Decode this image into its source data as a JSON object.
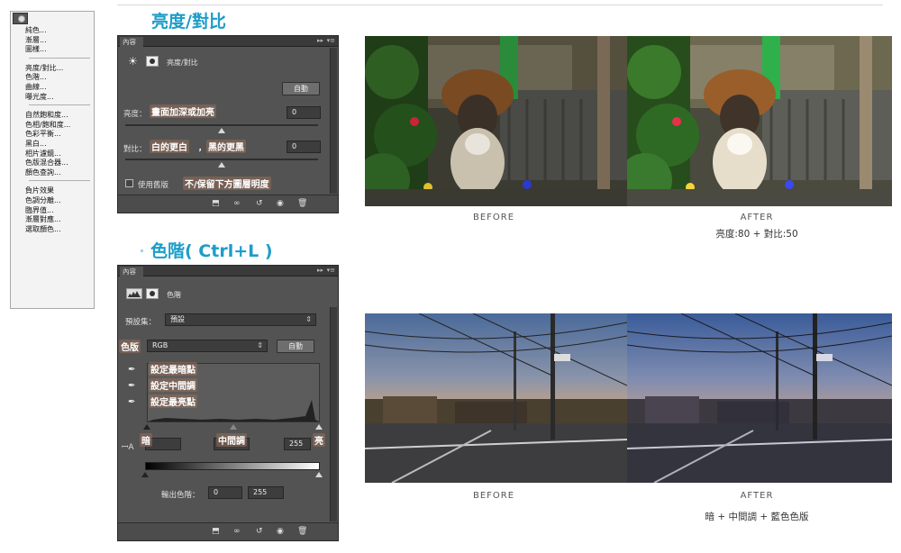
{
  "menu": {
    "items": [
      "純色...",
      "漸層...",
      "圖樣...",
      "—",
      "亮度/對比...",
      "色階...",
      "曲線...",
      "曝光度...",
      "—",
      "自然飽和度...",
      "色相/飽和度...",
      "色彩平衡...",
      "黑白...",
      "相片濾鏡...",
      "色版混合器...",
      "顏色查詢...",
      "—",
      "負片效果",
      "色調分離...",
      "臨界值...",
      "漸層對應...",
      "選取顏色..."
    ]
  },
  "section1": {
    "title": "亮度/對比",
    "panel": {
      "tab": "內容",
      "title": "亮度/對比",
      "auto_button": "自動",
      "brightness_label": "亮度：",
      "brightness_note": "畫面加深或加亮",
      "brightness_value": "0",
      "contrast_label": "對比：",
      "contrast_note_a": "白的更白",
      "contrast_note_sep": "，",
      "contrast_note_b": "黑的更黑",
      "contrast_value": "0",
      "legacy_label": "使用舊版",
      "legacy_note": "不/保留下方圖層明度"
    },
    "before_caption": "BEFORE",
    "after_caption": "AFTER",
    "after_sub": "亮度:80 + 對比:50"
  },
  "section2": {
    "title": "色階( Ctrl+L )",
    "panel": {
      "tab": "內容",
      "title": "色階",
      "preset_label": "預設集：",
      "preset_value": "預設",
      "channel_note": "色版",
      "channel_value": "RGB",
      "auto_button": "自動",
      "eyedrop_black": "設定最暗點",
      "eyedrop_gray": "設定中間調",
      "eyedrop_white": "設定最亮點",
      "shadow_note": "暗",
      "mid_note": "中間調",
      "high_note": "亮",
      "input_white": "255",
      "output_label": "輸出色階：",
      "output_black": "0",
      "output_white": "255"
    },
    "before_caption": "BEFORE",
    "after_caption": "AFTER",
    "after_sub": "暗 + 中間調 + 藍色色版"
  },
  "colors": {
    "accent": "#1c9dc9",
    "panel_bg": "#535353"
  },
  "icons": [
    "sun-icon",
    "mask-icon",
    "histogram-icon",
    "eyedropper-icon",
    "visibility-icon",
    "trash-icon",
    "reset-icon",
    "clip-icon",
    "link-icon"
  ]
}
